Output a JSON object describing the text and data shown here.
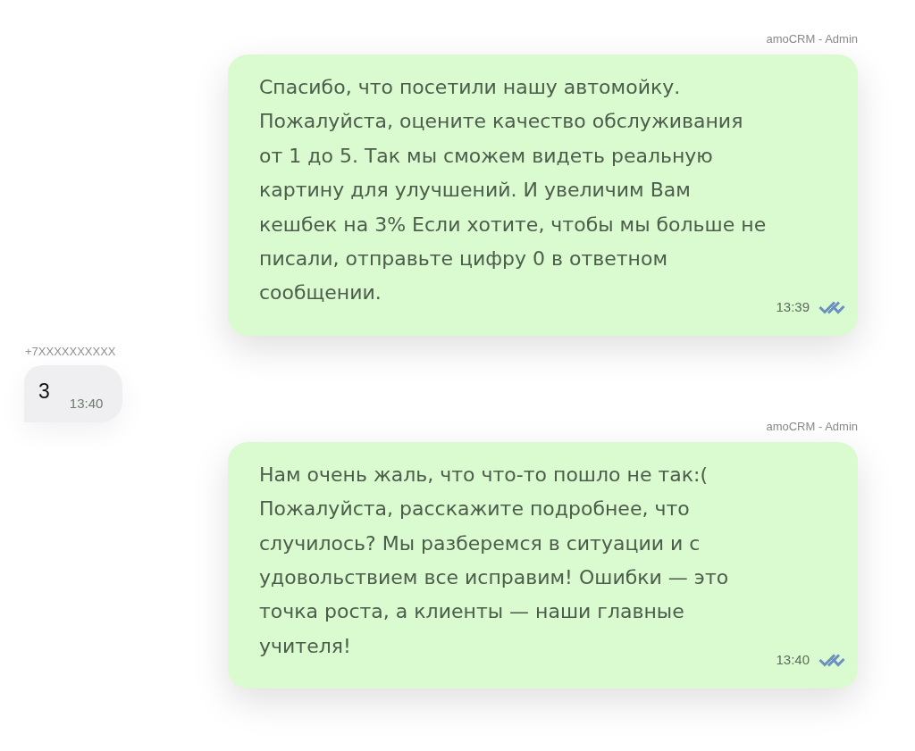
{
  "messages": [
    {
      "kind": "outgoing",
      "sender": "amoCRM - Admin",
      "text": "Спасибо, что посетили нашу автомойку.\nПожалуйста, оцените качество обслуживания\nот 1 до 5. Так мы сможем видеть реальную\nкартину для улучшений. И увеличим Вам\nкешбек на 3% Если хотите, чтобы мы больше не\nписали, отправьте цифру 0 в ответном\nсообщении.",
      "time": "13:39",
      "read": true
    },
    {
      "kind": "incoming",
      "sender": "+7XXXXXXXXXX",
      "text": "3",
      "time": "13:40"
    },
    {
      "kind": "outgoing",
      "sender": "amoCRM - Admin",
      "text": "Нам очень жаль, что что-то пошло не так:(\nПожалуйста, расскажите подробнее, что\nслучилось? Мы разберемся в ситуации и с\nудовольствием все исправим! Ошибки — это\nточка роста, а клиенты — наши главные\nучителя!",
      "time": "13:40",
      "read": true
    }
  ]
}
